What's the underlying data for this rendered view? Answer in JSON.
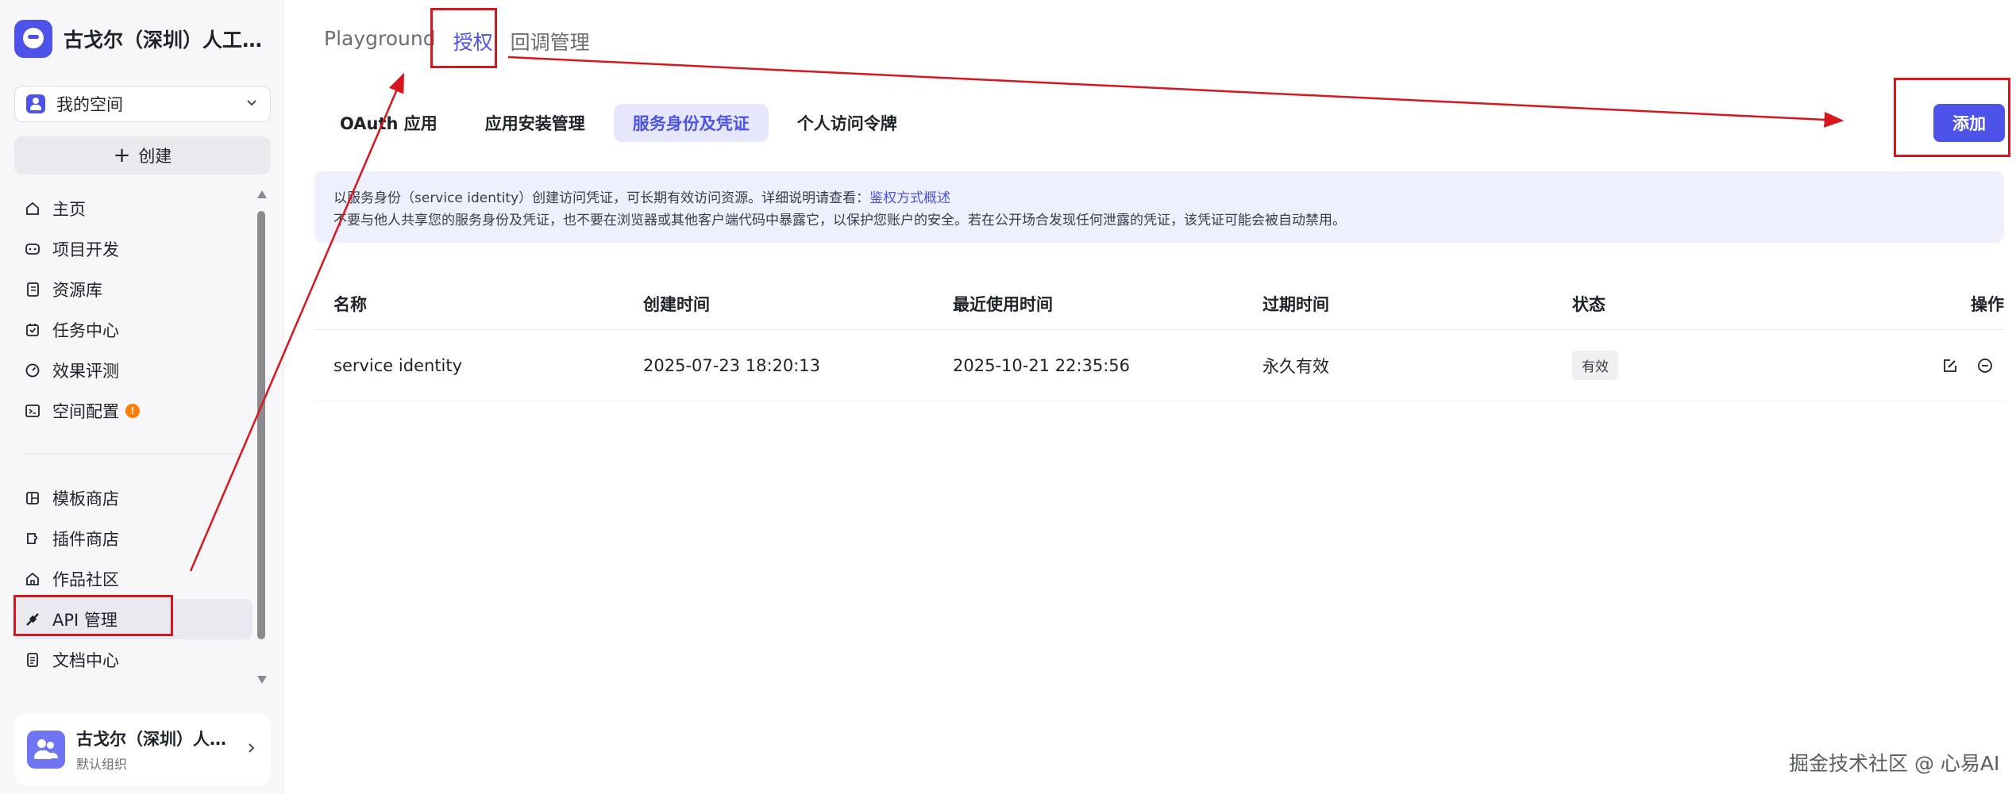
{
  "sidebar": {
    "brand_name": "古戈尔（深圳）人工…",
    "space_label": "我的空间",
    "create_label": "创建",
    "nav_main": [
      {
        "label": "主页",
        "icon": "home-icon"
      },
      {
        "label": "项目开发",
        "icon": "robot-icon"
      },
      {
        "label": "资源库",
        "icon": "library-icon"
      },
      {
        "label": "任务中心",
        "icon": "task-icon"
      },
      {
        "label": "效果评测",
        "icon": "gauge-icon"
      },
      {
        "label": "空间配置",
        "icon": "terminal-icon",
        "badge": "!"
      }
    ],
    "nav_secondary": [
      {
        "label": "模板商店",
        "icon": "template-icon"
      },
      {
        "label": "插件商店",
        "icon": "plugin-icon"
      },
      {
        "label": "作品社区",
        "icon": "community-icon"
      },
      {
        "label": "API 管理",
        "icon": "api-icon",
        "active": true
      },
      {
        "label": "文档中心",
        "icon": "document-icon"
      }
    ],
    "org": {
      "name": "古戈尔（深圳）人…",
      "sub": "默认组织"
    }
  },
  "main": {
    "top_tabs": [
      {
        "label": "Playground",
        "active": false
      },
      {
        "label": "授权",
        "active": true
      },
      {
        "label": "回调管理",
        "active": false
      }
    ],
    "sub_tabs": [
      {
        "label": "OAuth 应用",
        "active": false
      },
      {
        "label": "应用安装管理",
        "active": false
      },
      {
        "label": "服务身份及凭证",
        "active": true
      },
      {
        "label": "个人访问令牌",
        "active": false
      }
    ],
    "add_label": "添加",
    "notice": {
      "line1": "以服务身份（service identity）创建访问凭证，可长期有效访问资源。详细说明请查看：",
      "link": "鉴权方式概述",
      "line2": "不要与他人共享您的服务身份及凭证，也不要在浏览器或其他客户端代码中暴露它，以保护您账户的安全。若在公开场合发现任何泄露的凭证，该凭证可能会被自动禁用。"
    },
    "table": {
      "headers": [
        "名称",
        "创建时间",
        "最近使用时间",
        "过期时间",
        "状态",
        "操作"
      ],
      "rows": [
        {
          "name": "service identity",
          "created": "2025-07-23 18:20:13",
          "last_used": "2025-10-21 22:35:56",
          "expires": "永久有效",
          "status": "有效"
        }
      ]
    }
  },
  "watermark": "掘金技术社区 @ 心易AI",
  "colors": {
    "accent": "#4d53e8",
    "annotation": "#d9151d",
    "warning": "#ff7d00"
  }
}
